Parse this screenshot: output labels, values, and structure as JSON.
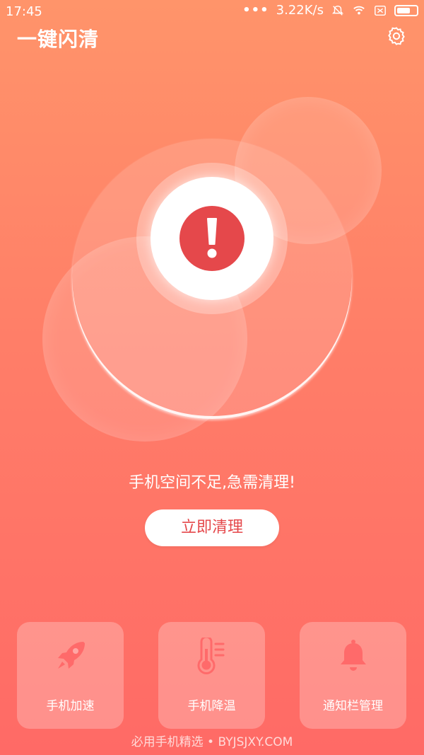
{
  "status_bar": {
    "time": "17:45",
    "dots": "•••",
    "speed": "3.22K/s",
    "icons": [
      "bell-mute-icon",
      "wifi-icon",
      "sim-x-icon",
      "battery-icon"
    ]
  },
  "header": {
    "title": "一键闪清",
    "settings_icon": "gear-icon"
  },
  "main": {
    "alert_icon": "exclamation-icon",
    "message": "手机空间不足,急需清理!",
    "clean_button": "立即清理"
  },
  "features": [
    {
      "label": "手机加速",
      "icon": "rocket-icon"
    },
    {
      "label": "手机降温",
      "icon": "thermometer-icon"
    },
    {
      "label": "通知栏管理",
      "icon": "bell-icon"
    }
  ],
  "footer": {
    "watermark": "必用手机精选 • BYJSJXY.COM"
  },
  "colors": {
    "bg_top": "#FF946A",
    "bg_bottom": "#FF6A66",
    "alert_red": "#E5484B",
    "icon_red": "#FF6A6A"
  }
}
